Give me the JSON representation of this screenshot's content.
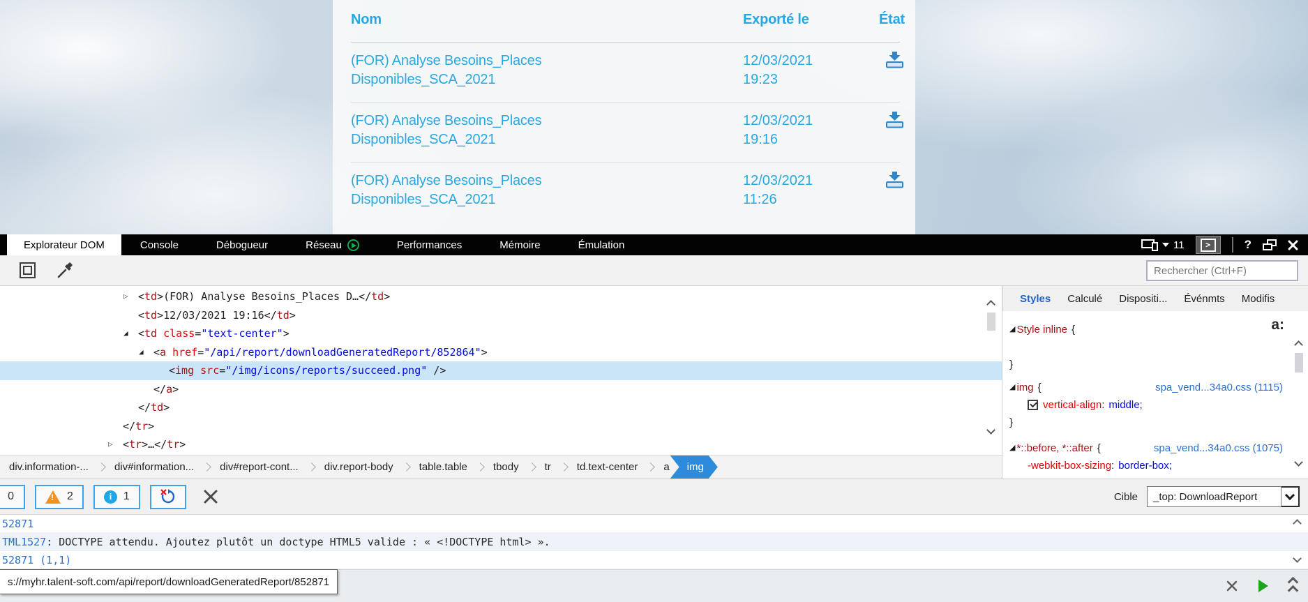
{
  "page": {
    "table": {
      "headers": [
        "Nom",
        "Exporté le",
        "État"
      ],
      "rows": [
        {
          "name_line1": "(FOR) Analyse Besoins_Places",
          "name_line2": "Disponibles_SCA_2021",
          "date": "12/03/2021",
          "time": "19:23"
        },
        {
          "name_line1": "(FOR) Analyse Besoins_Places",
          "name_line2": "Disponibles_SCA_2021",
          "date": "12/03/2021",
          "time": "19:16"
        },
        {
          "name_line1": "(FOR) Analyse Besoins_Places",
          "name_line2": "Disponibles_SCA_2021",
          "date": "12/03/2021",
          "time": "11:26"
        }
      ]
    }
  },
  "devtools": {
    "tabs": [
      {
        "label": "Explorateur DOM",
        "active": true
      },
      {
        "label": "Console"
      },
      {
        "label": "Débogueur"
      },
      {
        "label": "Réseau",
        "icon": "play-circle"
      },
      {
        "label": "Performances"
      },
      {
        "label": "Mémoire"
      },
      {
        "label": "Émulation"
      }
    ],
    "titlebar": {
      "version": "11",
      "help": "?"
    },
    "toolbar": {
      "search_placeholder": "Rechercher (Ctrl+F)"
    },
    "icons": {
      "expanded": "◢",
      "collapsed": "▷"
    },
    "dom_tree": {
      "lines": [
        {
          "arrow": "closed",
          "indent": 198,
          "tokens": [
            [
              "p",
              "<"
            ],
            [
              "tag",
              "td"
            ],
            [
              "p",
              ">"
            ],
            [
              "tx",
              "(FOR) Analyse Besoins_Places D…"
            ],
            [
              "p",
              "</"
            ],
            [
              "tag",
              "td"
            ],
            [
              "p",
              ">"
            ]
          ]
        },
        {
          "indent": 198,
          "tokens": [
            [
              "p",
              "<"
            ],
            [
              "tag",
              "td"
            ],
            [
              "p",
              ">"
            ],
            [
              "tx",
              "12/03/2021 19:16"
            ],
            [
              "p",
              "</"
            ],
            [
              "tag",
              "td"
            ],
            [
              "p",
              ">"
            ]
          ]
        },
        {
          "arrow": "open",
          "indent": 198,
          "tokens": [
            [
              "p",
              "<"
            ],
            [
              "tag",
              "td"
            ],
            [
              "tx",
              " "
            ],
            [
              "attr",
              "class"
            ],
            [
              "p",
              "="
            ],
            [
              "val",
              "\"text-center\""
            ],
            [
              "p",
              ">"
            ]
          ]
        },
        {
          "arrow": "open",
          "indent": 220,
          "tokens": [
            [
              "p",
              "<"
            ],
            [
              "tag",
              "a"
            ],
            [
              "tx",
              " "
            ],
            [
              "attr",
              "href"
            ],
            [
              "p",
              "="
            ],
            [
              "val",
              "\"/api/report/downloadGeneratedReport/852864\""
            ],
            [
              "p",
              ">"
            ]
          ]
        },
        {
          "highlight": true,
          "indent": 242,
          "tokens": [
            [
              "p",
              "<"
            ],
            [
              "tag",
              "img"
            ],
            [
              "tx",
              " "
            ],
            [
              "attr",
              "src"
            ],
            [
              "p",
              "="
            ],
            [
              "val",
              "\"/img/icons/reports/succeed.png\""
            ],
            [
              "p",
              " />"
            ]
          ]
        },
        {
          "indent": 220,
          "tokens": [
            [
              "p",
              "</"
            ],
            [
              "tag",
              "a"
            ],
            [
              "p",
              ">"
            ]
          ]
        },
        {
          "indent": 198,
          "tokens": [
            [
              "p",
              "</"
            ],
            [
              "tag",
              "td"
            ],
            [
              "p",
              ">"
            ]
          ]
        },
        {
          "indent": 176,
          "tokens": [
            [
              "p",
              "</"
            ],
            [
              "tag",
              "tr"
            ],
            [
              "p",
              ">"
            ]
          ]
        },
        {
          "arrow": "closed",
          "indent": 176,
          "tokens": [
            [
              "p",
              "<"
            ],
            [
              "tag",
              "tr"
            ],
            [
              "p",
              ">"
            ],
            [
              "tx",
              "…"
            ],
            [
              "p",
              "</"
            ],
            [
              "tag",
              "tr"
            ],
            [
              "p",
              ">"
            ]
          ]
        }
      ]
    },
    "breadcrumb": {
      "items": [
        {
          "label": "div.information-..."
        },
        {
          "label": "div#information..."
        },
        {
          "label": "div#report-cont..."
        },
        {
          "label": "div.report-body"
        },
        {
          "label": "table.table"
        },
        {
          "label": "tbody"
        },
        {
          "label": "tr"
        },
        {
          "label": "td.text-center"
        },
        {
          "label": "a"
        },
        {
          "label": "img",
          "active": true
        }
      ]
    },
    "styles_panel": {
      "tabs": [
        {
          "label": "Styles",
          "active": true
        },
        {
          "label": "Calculé"
        },
        {
          "label": "Dispositi..."
        },
        {
          "label": "Événmts"
        },
        {
          "label": "Modifis"
        }
      ],
      "pseudo_button": "a:",
      "rules": [
        {
          "selector": "Style inline",
          "brace": "{",
          "empty_line": true,
          "props": [],
          "close": "}"
        },
        {
          "selector": "img",
          "brace": "{",
          "link": "spa_vend...34a0.css (1115)",
          "props": [
            {
              "checked": true,
              "name": "vertical-align",
              "value": "middle;"
            }
          ],
          "close": "}"
        },
        {
          "selector": "*::before, *::after",
          "brace": "{",
          "link": "spa_vend...34a0.css (1075)",
          "props": [
            {
              "checked": false,
              "name": "-webkit-box-sizing",
              "value": "border-box;"
            }
          ]
        }
      ]
    },
    "console": {
      "toolbar": {
        "error_count": "0",
        "warning_count": "2",
        "info_count": "1"
      },
      "target_label": "Cible",
      "target_value": "_top: DownloadReport",
      "messages": [
        {
          "parts": [
            {
              "c": "blue",
              "t": "52871"
            }
          ]
        },
        {
          "shaded": true,
          "parts": [
            {
              "c": "blue",
              "t": "TML1527"
            },
            {
              "c": "plain",
              "t": ": DOCTYPE attendu. Ajoutez plutôt un doctype HTML5 valide : « <!DOCTYPE html> »."
            }
          ]
        },
        {
          "parts": [
            {
              "c": "blue",
              "t": "52871 (1,1)"
            }
          ]
        }
      ]
    },
    "status_tooltip": "s://myhr.talent-soft.com/api/report/downloadGeneratedReport/852871"
  }
}
